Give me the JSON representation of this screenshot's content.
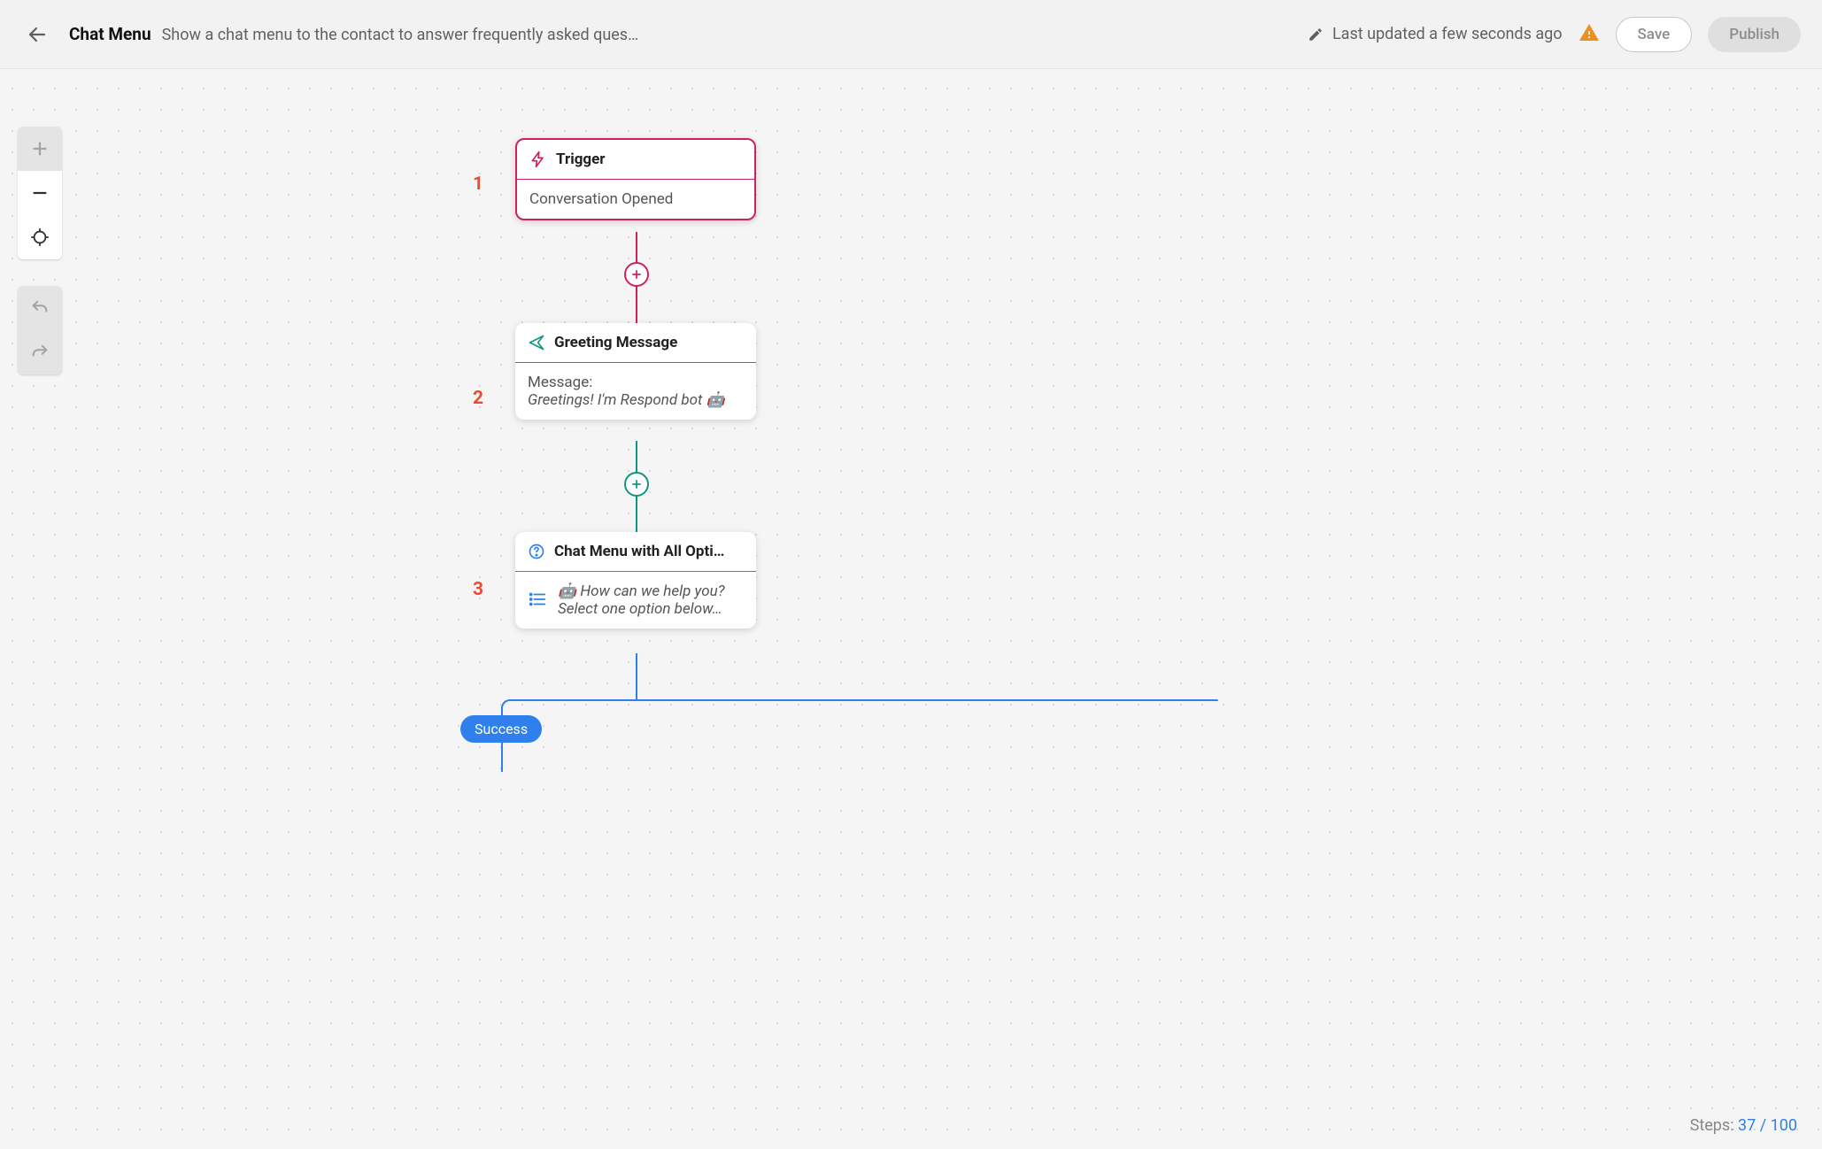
{
  "header": {
    "title": "Chat Menu",
    "subtitle": "Show a chat menu to the contact to answer frequently asked questio…",
    "last_updated": "Last updated a few seconds ago",
    "save_label": "Save",
    "publish_label": "Publish"
  },
  "callouts": {
    "n1": "1",
    "n2": "2",
    "n3": "3"
  },
  "nodes": {
    "trigger": {
      "title": "Trigger",
      "body": "Conversation Opened"
    },
    "greeting": {
      "title": "Greeting Message",
      "label": "Message:",
      "message": "Greetings! I'm Respond bot 🤖"
    },
    "menu": {
      "title": "Chat Menu with All Opti…",
      "line1": "🤖 How can we help you?",
      "line2": "Select one option below…"
    }
  },
  "branch": {
    "success_label": "Success"
  },
  "counter": {
    "label": "Steps:",
    "current": "37",
    "sep": " / ",
    "total": "100"
  }
}
